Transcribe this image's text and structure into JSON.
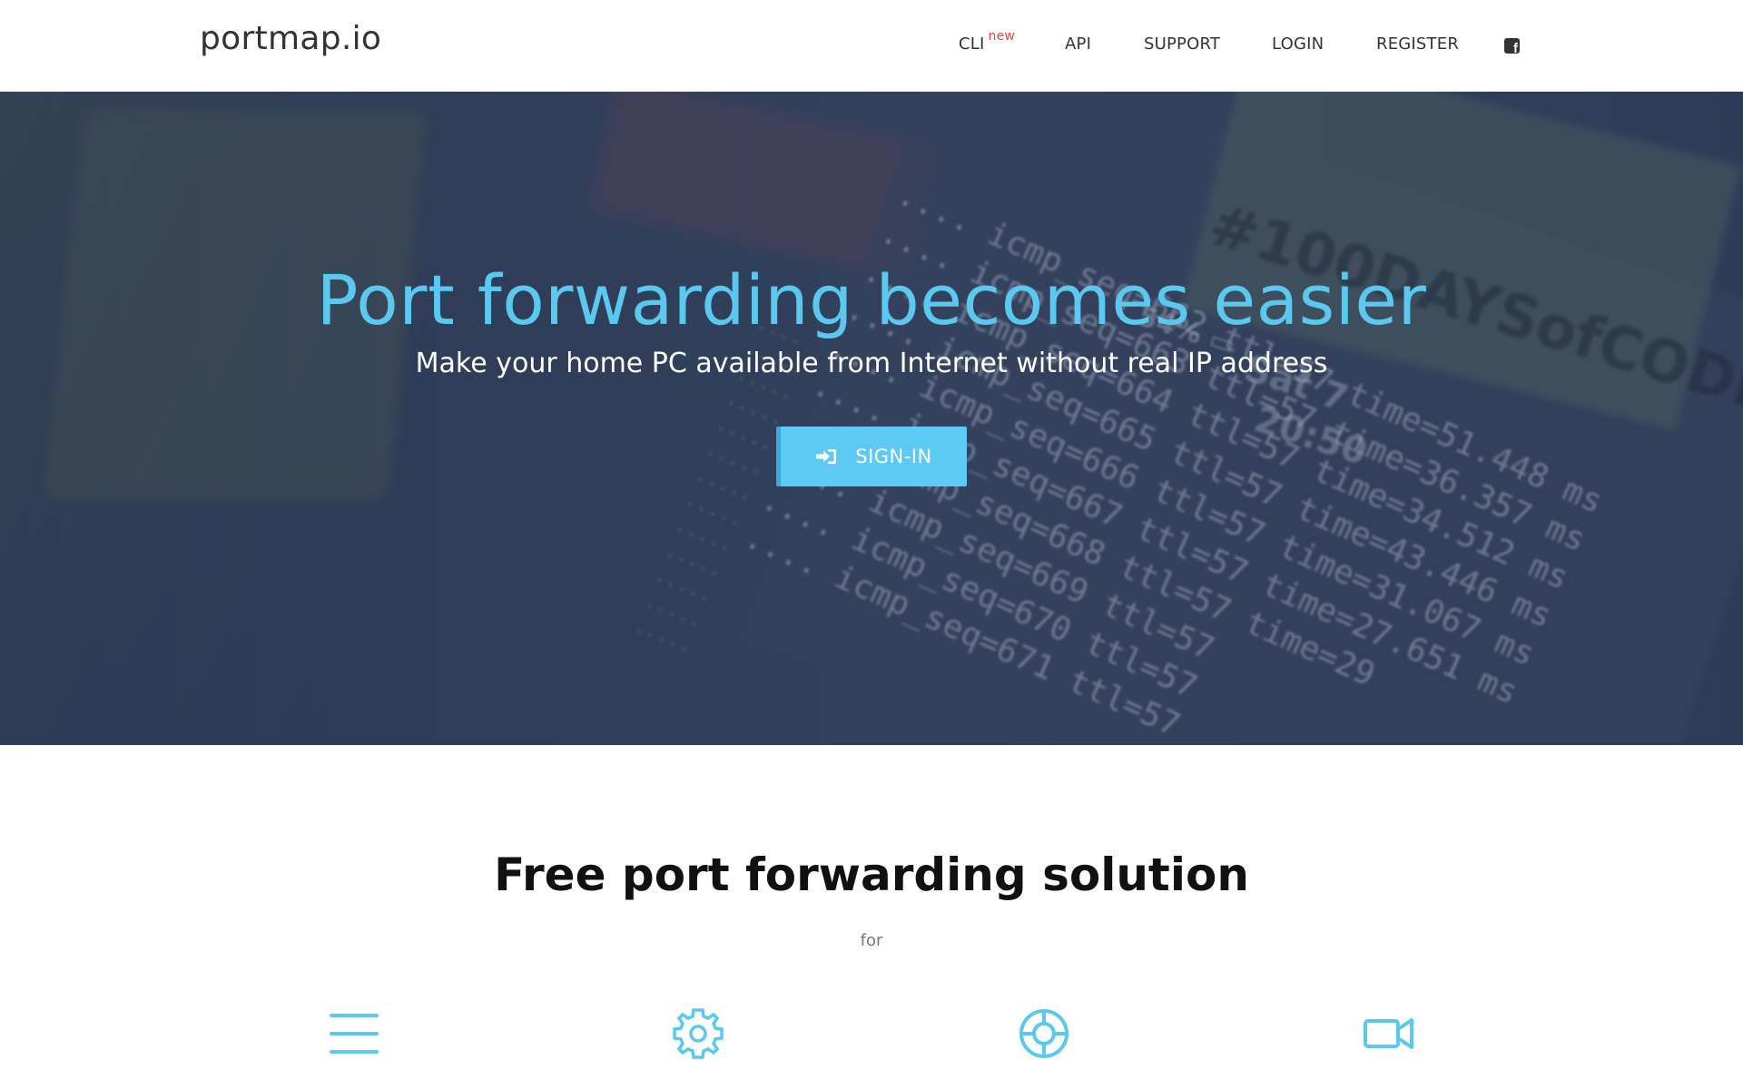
{
  "navbar": {
    "brand": "portmap.io",
    "links": {
      "cli": "CLI",
      "cli_badge": "new",
      "api": "API",
      "support": "SUPPORT",
      "login": "LOGIN",
      "register": "REGISTER"
    },
    "social_icon": "facebook-icon"
  },
  "hero": {
    "title": "Port forwarding becomes easier",
    "subtitle": "Make your home PC available from Internet without real IP address",
    "signin_label": "SIGN-IN",
    "signin_icon": "sign-in-icon",
    "title_color": "#5bc8f0",
    "button_color": "#5ccaf2"
  },
  "features": {
    "title": "Free port forwarding solution",
    "subtitle": "for",
    "icons": [
      "menu-icon",
      "gear-icon",
      "lifebuoy-icon",
      "video-camera-icon"
    ]
  }
}
